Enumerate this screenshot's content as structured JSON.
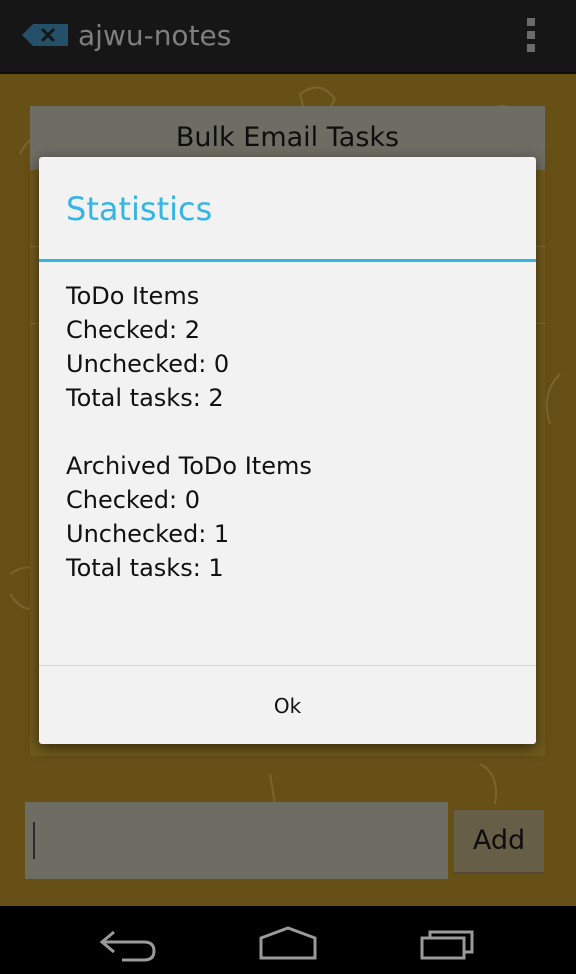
{
  "app": {
    "title": "ajwu-notes",
    "icon": "note-x-icon",
    "overflow_icon": "overflow-menu-icon"
  },
  "note": {
    "title": "Bulk Email Tasks"
  },
  "input": {
    "value": "",
    "placeholder": ""
  },
  "add_button": {
    "label": "Add"
  },
  "dialog": {
    "title": "Statistics",
    "todo": {
      "heading": "ToDo Items",
      "checked": "Checked: 2",
      "unchecked": "Unchecked: 0",
      "total": "Total tasks: 2"
    },
    "archived": {
      "heading": "Archived ToDo Items",
      "checked": "Checked: 0",
      "unchecked": "Unchecked: 1",
      "total": "Total tasks: 1"
    },
    "ok_label": "Ok"
  },
  "nav": {
    "back_icon": "back-icon",
    "home_icon": "home-icon",
    "recents_icon": "recents-icon"
  },
  "colors": {
    "accent": "#33b5e5",
    "action_bar": "#161616",
    "dim_background": "#675016",
    "dialog_background": "#f2f2f2"
  }
}
